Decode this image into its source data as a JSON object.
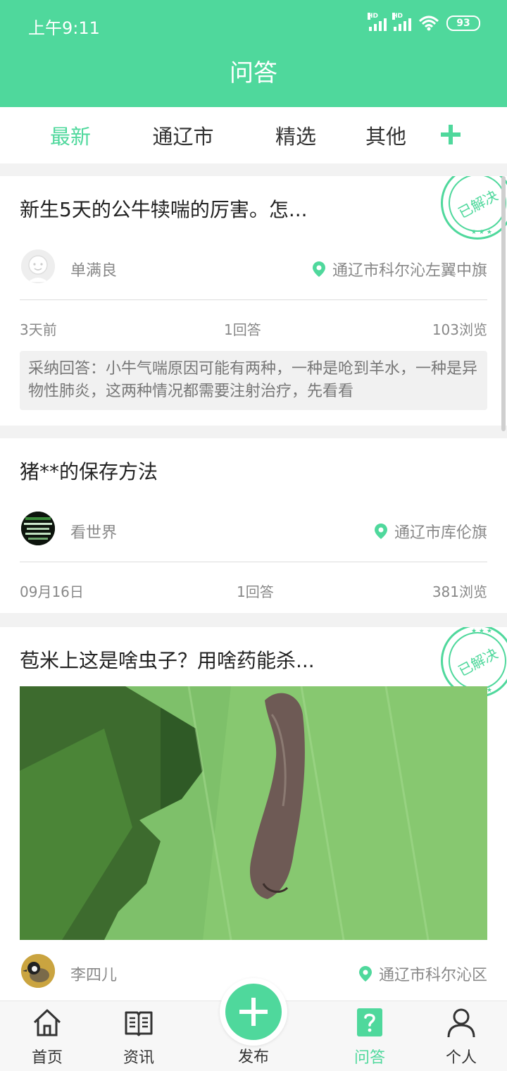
{
  "status_bar": {
    "time": "上午9:11",
    "battery": "93",
    "signal_label": "HD"
  },
  "header": {
    "title": "问答"
  },
  "tabs": [
    {
      "label": "最新",
      "active": true
    },
    {
      "label": "通辽市",
      "active": false
    },
    {
      "label": "精选",
      "active": false
    },
    {
      "label": "其他",
      "active": false
    }
  ],
  "tab_add_icon": "plus-icon",
  "stamp_text": "已解决",
  "posts": [
    {
      "title": "新生5天的公牛犊喘的厉害。怎...",
      "user": "单满良",
      "location": "通辽市科尔沁左翼中旗",
      "time": "3天前",
      "answers": "1回答",
      "views": "103浏览",
      "adopted_answer": "采纳回答：小牛气喘原因可能有两种，一种是呛到羊水，一种是异物性肺炎，这两种情况都需要注射治疗，先看看",
      "solved": true
    },
    {
      "title": "猪**的保存方法",
      "user": "看世界",
      "location": "通辽市库伦旗",
      "time": "09月16日",
      "answers": "1回答",
      "views": "381浏览",
      "solved": false
    },
    {
      "title": "苞米上这是啥虫子？用啥药能杀...",
      "user": "李四儿",
      "location": "通辽市科尔沁区",
      "solved": true,
      "image": "caterpillar-on-corn-leaf"
    }
  ],
  "bottom_nav": [
    {
      "label": "首页",
      "icon": "home-icon"
    },
    {
      "label": "资讯",
      "icon": "book-icon"
    },
    {
      "label": "发布",
      "icon": "plus-icon"
    },
    {
      "label": "问答",
      "icon": "question-icon",
      "active": true
    },
    {
      "label": "个人",
      "icon": "person-icon"
    }
  ],
  "colors": {
    "accent": "#4fd89c",
    "background": "#f2f2f2",
    "muted_text": "#888888"
  }
}
